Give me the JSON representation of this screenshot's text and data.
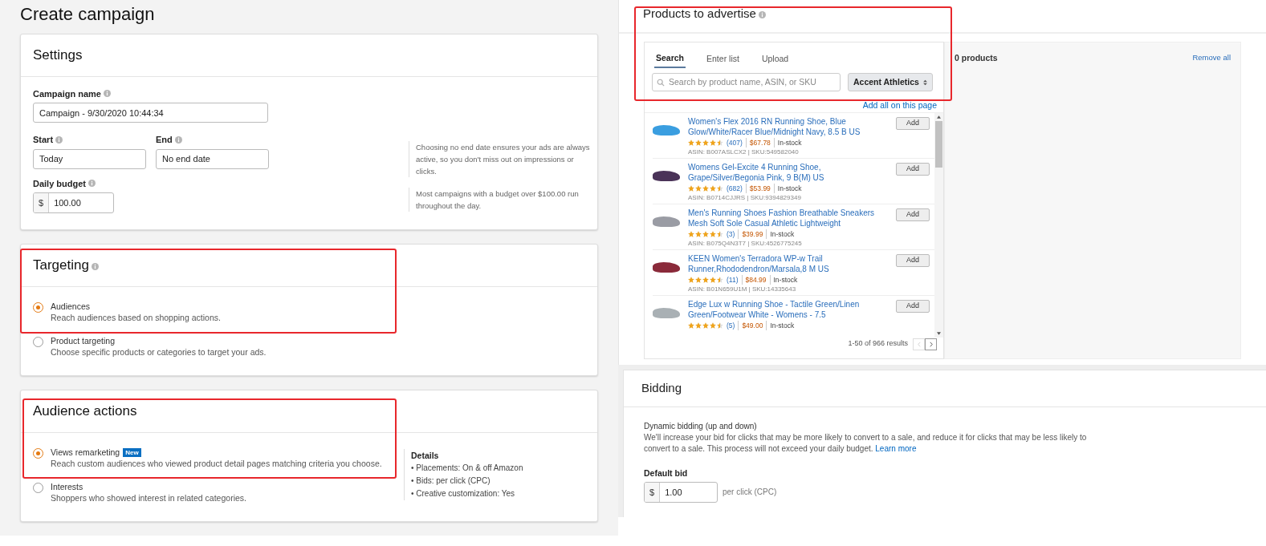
{
  "page_title": "Create campaign",
  "settings": {
    "title": "Settings",
    "campaign_name": {
      "label": "Campaign name",
      "value": "Campaign - 9/30/2020 10:44:34"
    },
    "start": {
      "label": "Start",
      "value": "Today"
    },
    "end": {
      "label": "End",
      "value": "No end date"
    },
    "end_hint": "Choosing no end date ensures your ads are always active, so you don't miss out on impressions or clicks.",
    "budget": {
      "label": "Daily budget",
      "currency": "$",
      "value": "100.00"
    },
    "budget_hint": "Most campaigns with a budget over $100.00 run throughout the day."
  },
  "targeting": {
    "title": "Targeting",
    "options": [
      {
        "label": "Audiences",
        "description": "Reach audiences based on shopping actions.",
        "selected": true
      },
      {
        "label": "Product targeting",
        "description": "Choose specific products or categories to target your ads.",
        "selected": false
      }
    ]
  },
  "audience_actions": {
    "title": "Audience actions",
    "options": [
      {
        "label": "Views remarketing",
        "badge": "New",
        "description": "Reach custom audiences who viewed product detail pages matching criteria you choose.",
        "selected": true
      },
      {
        "label": "Interests",
        "description": "Shoppers who showed interest in related categories.",
        "selected": false
      }
    ],
    "details": {
      "title": "Details",
      "items": [
        "• Placements: On & off Amazon",
        "• Bids: per click (CPC)",
        "• Creative customization: Yes"
      ]
    }
  },
  "products": {
    "title": "Products to advertise",
    "tabs": [
      {
        "label": "Search",
        "selected": true
      },
      {
        "label": "Enter list",
        "selected": false
      },
      {
        "label": "Upload",
        "selected": false
      }
    ],
    "search": {
      "placeholder": "Search by product name, ASIN, or SKU"
    },
    "brand": "Accent Athletics",
    "add_all": "Add all on this page",
    "items": [
      {
        "title": "Women's Flex 2016 RN Running Shoe, Blue Glow/White/Racer Blue/Midnight Navy, 8.5 B US",
        "stars": 4.5,
        "reviews": "(407)",
        "price": "$67.78",
        "stock": "In-stock",
        "ids": "ASIN: B007ASLCX2 | SKU:549582040",
        "button": "Add",
        "color": "#3a9ee0"
      },
      {
        "title": "Womens Gel-Excite 4 Running Shoe, Grape/Silver/Begonia Pink, 9 B(M) US",
        "stars": 4.5,
        "reviews": "(682)",
        "price": "$53.99",
        "stock": "In-stock",
        "ids": "ASIN: B0714CJJRS | SKU:9394829349",
        "button": "Add",
        "color": "#4a3358"
      },
      {
        "title": "Men's Running Shoes Fashion Breathable Sneakers Mesh Soft Sole Casual Athletic Lightweight",
        "stars": 4.5,
        "reviews": "(3)",
        "price": "$39.99",
        "stock": "In-stock",
        "ids": "ASIN: B075Q4N3T7 | SKU:4526775245",
        "button": "Add",
        "color": "#9a9ca4"
      },
      {
        "title": "KEEN Women's Terradora WP-w Trail Runner,Rhododendron/Marsala,8 M US",
        "stars": 4.5,
        "reviews": "(11)",
        "price": "$84.99",
        "stock": "In-stock",
        "ids": "ASIN: B01N659U1M | SKU:14335643",
        "button": "Add",
        "color": "#8a2a3a"
      },
      {
        "title": "Edge Lux w Running Shoe - Tactile Green/Linen Green/Footwear White - Womens - 7.5",
        "stars": 4.5,
        "reviews": "(5)",
        "price": "$49.00",
        "stock": "In-stock",
        "button": "Add",
        "color": "#a9b0b4"
      }
    ],
    "results": "1-50 of 966 results",
    "count": "0 products",
    "remove_all": "Remove all"
  },
  "bidding": {
    "title": "Bidding",
    "strategy": "Dynamic bidding (up and down)",
    "description": "We'll increase your bid for clicks that may be more likely to convert to a sale, and reduce it for clicks that may be less likely to convert to a sale. This process will not exceed your daily budget.",
    "learn_more": "Learn more",
    "default_bid": {
      "label": "Default bid",
      "currency": "$",
      "value": "1.00",
      "unit": "per click (CPC)"
    }
  }
}
